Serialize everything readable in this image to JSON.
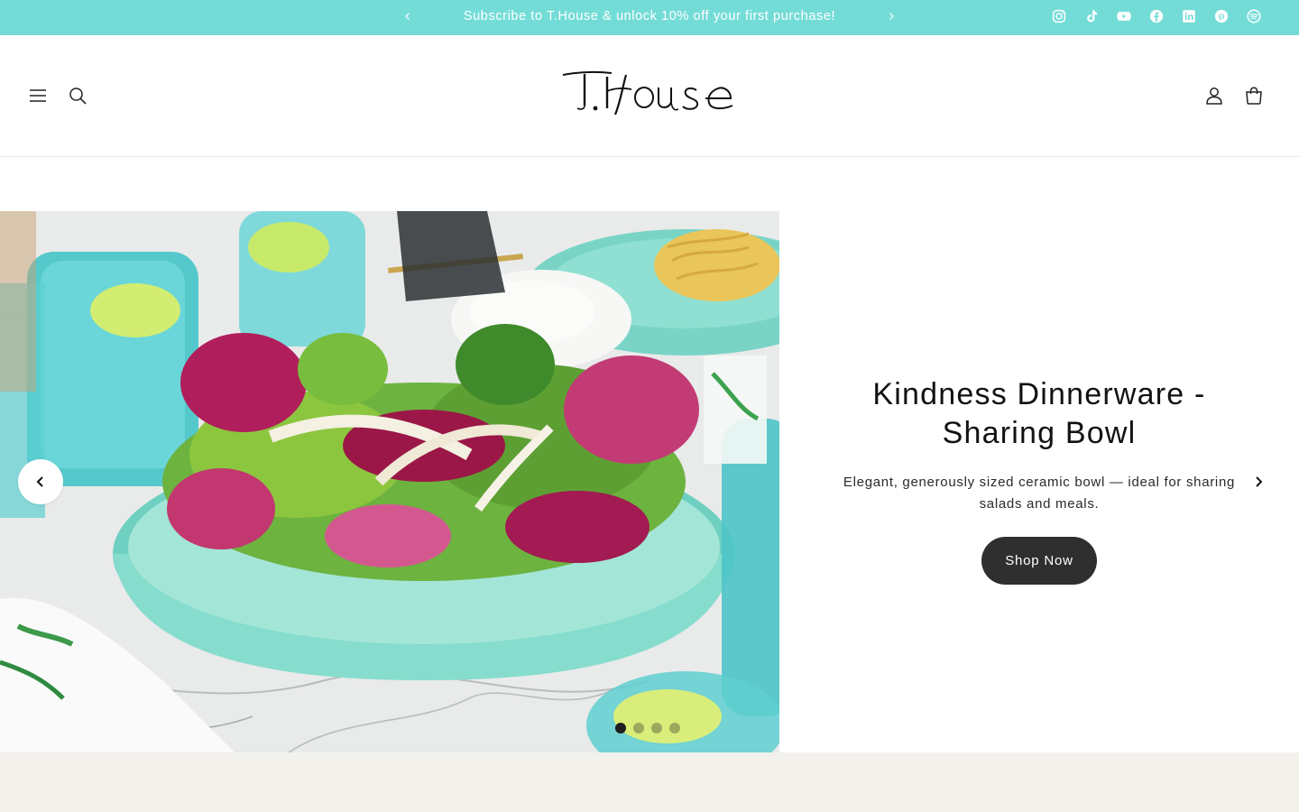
{
  "announcement": {
    "text": "Subscribe to T.House & unlock 10% off your first purchase!",
    "prev_icon": "chevron-left-icon",
    "next_icon": "chevron-right-icon",
    "background": "#74dcd7"
  },
  "social": [
    "instagram-icon",
    "tiktok-icon",
    "youtube-icon",
    "facebook-icon",
    "linkedin-icon",
    "pinterest-icon",
    "spotify-icon"
  ],
  "header": {
    "logo": "T.House",
    "menu_icon": "menu-icon",
    "search_icon": "search-icon",
    "account_icon": "account-icon",
    "cart_icon": "cart-icon"
  },
  "hero": {
    "title": "Kindness Dinnerware - Sharing Bowl",
    "description": "Elegant, generously sized ceramic bowl — ideal for sharing salads and meals.",
    "button": "Shop Now",
    "slides_count": 4,
    "active_slide": 1,
    "button_color": "#2f2f2f"
  },
  "colors": {
    "band": "#f2f1ec",
    "text": "#121212"
  }
}
